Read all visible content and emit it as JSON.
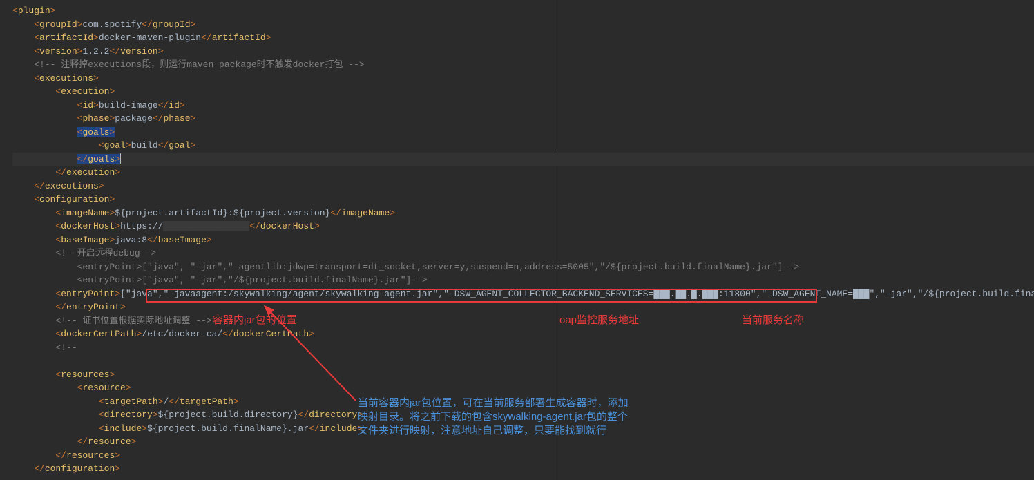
{
  "code": {
    "l1": {
      "tag": "plugin"
    },
    "l2": {
      "tag": "groupId",
      "text": "com.spotify"
    },
    "l3": {
      "tag": "artifactId",
      "text": "docker-maven-plugin"
    },
    "l4": {
      "tag": "version",
      "text": "1.2.2"
    },
    "l5": {
      "comment": "<!-- 注释掉executions段，则运行maven package时不触发docker打包 -->"
    },
    "l6": {
      "tag": "executions"
    },
    "l7": {
      "tag": "execution"
    },
    "l8": {
      "tag": "id",
      "text": "build-image"
    },
    "l9": {
      "tag": "phase",
      "text": "package"
    },
    "l10": {
      "tag": "goals"
    },
    "l11": {
      "tag": "goal",
      "text": "build"
    },
    "l12": {
      "tag": "goals"
    },
    "l13": {
      "tag": "execution"
    },
    "l14": {
      "tag": "executions"
    },
    "l15": {
      "tag": "configuration"
    },
    "l16": {
      "tag": "imageName",
      "text": "${project.artifactId}:${project.version}"
    },
    "l17": {
      "tag": "dockerHost",
      "text_a": "https://",
      "text_b": ""
    },
    "l18": {
      "tag": "baseImage",
      "text": "java:8"
    },
    "l19": {
      "comment": "<!--开启远程debug-->"
    },
    "l20": {
      "comment": "<entryPoint>[\"java\", \"-jar\",\"-agentlib:jdwp=transport=dt_socket,server=y,suspend=n,address=5005\",\"/${project.build.finalName}.jar\"]-->"
    },
    "l21": {
      "comment": "<entryPoint>[\"java\", \"-jar\",\"/${project.build.finalName}.jar\"]-->"
    },
    "l22": {
      "tag": "entryPoint",
      "text": "[\"java\",\"-javaagent:/skywalking/agent/skywalking-agent.jar\",\"-DSW_AGENT_COLLECTOR_BACKEND_SERVICES=███.██.█.███:11800\",\"-DSW_AGENT_NAME=███\",\"-jar\",\"/${project.build.finalName}.jar\"]"
    },
    "l23": {
      "tag": "entryPoint"
    },
    "l24": {
      "comment": "<!-- 证书位置根据实际地址调整 -->"
    },
    "l25": {
      "tag": "dockerCertPath",
      "text": "/etc/docker-ca/"
    },
    "l26": {
      "comment": "<!--"
    },
    "l27": {
      "comment": ""
    },
    "l28": {
      "tag": "resources"
    },
    "l29": {
      "tag": "resource"
    },
    "l30": {
      "tag": "targetPath",
      "text": "/"
    },
    "l31": {
      "tag": "directory",
      "text": "${project.build.directory}"
    },
    "l32": {
      "tag": "include",
      "text": "${project.build.finalName}.jar"
    },
    "l33": {
      "tag": "resource"
    },
    "l34": {
      "tag": "resources"
    },
    "l35": {
      "tag": "configuration"
    }
  },
  "annotations": {
    "red1": "容器内jar包的位置",
    "red2": "oap监控服务地址",
    "red3": "当前服务名称",
    "blue_l1": "当前容器内jar包位置，可在当前服务部署生成容器时，添加",
    "blue_l2": "映射目录。将之前下载的包含skywalking-agent.jar包的整个",
    "blue_l3": "文件夹进行映射，注意地址自己调整，只要能找到就行"
  }
}
